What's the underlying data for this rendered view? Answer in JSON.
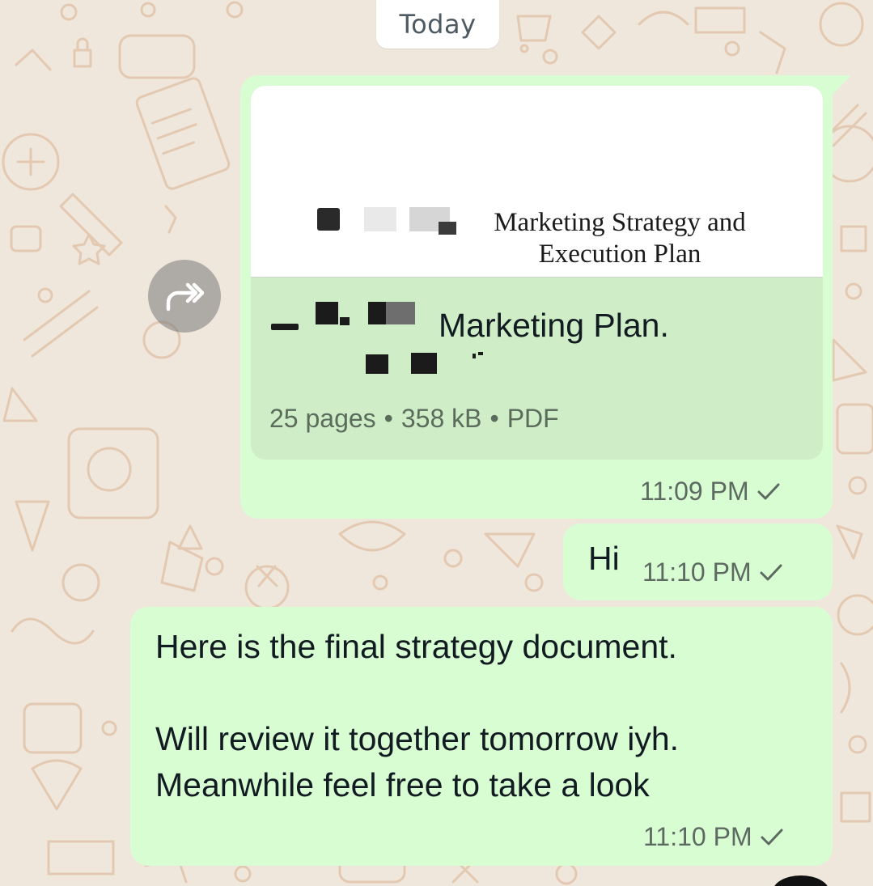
{
  "date_divider": "Today",
  "document_message": {
    "preview_title": "Marketing Strategy and Execution Plan",
    "file_name": "Marketing Plan.",
    "meta": {
      "pages": "25 pages",
      "size": "358 kB",
      "type": "PDF"
    },
    "time": "11:09 PM",
    "status_icon": "single-check-icon"
  },
  "hi_message": {
    "text": "Hi",
    "time": "11:10 PM",
    "status_icon": "single-check-icon"
  },
  "strategy_message": {
    "text": "Here is the final strategy document.\n\nWill review it together tomorrow iyh.\nMeanwhile feel free to take a look",
    "time": "11:10 PM",
    "status_icon": "single-check-icon"
  },
  "forward_icon": "forward-icon",
  "colors": {
    "outgoing_bubble": "#d9fdd3",
    "doc_card": "#cfeec7",
    "wallpaper": "#efe7dc",
    "wallpaper_doodle": "#e7cfb9",
    "meta_text": "#5d6a61"
  }
}
